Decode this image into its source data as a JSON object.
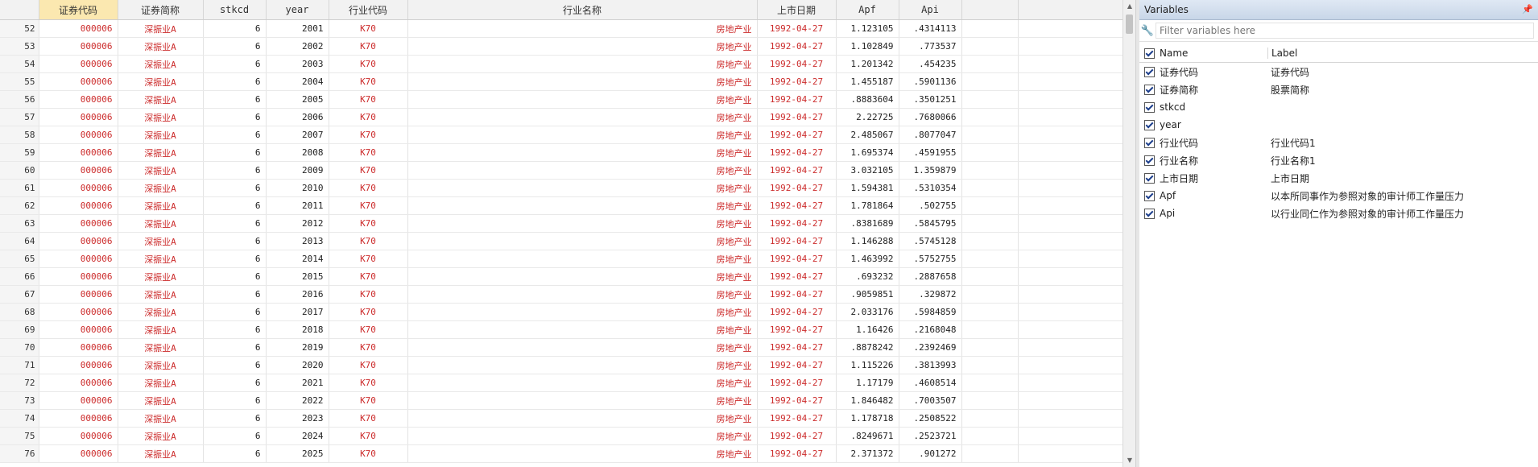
{
  "data_grid": {
    "columns": [
      "",
      "证券代码",
      "证券简称",
      "stkcd",
      "year",
      "行业代码",
      "行业名称",
      "上市日期",
      "Apf",
      "Api",
      "",
      ""
    ],
    "rows": [
      {
        "n": "52",
        "code": "000006",
        "short": "深振业A",
        "stkcd": "6",
        "year": "2001",
        "ind": "K70",
        "indname": "房地产业",
        "date": "1992-04-27",
        "apf": "1.123105",
        "api": ".4314113"
      },
      {
        "n": "53",
        "code": "000006",
        "short": "深振业A",
        "stkcd": "6",
        "year": "2002",
        "ind": "K70",
        "indname": "房地产业",
        "date": "1992-04-27",
        "apf": "1.102849",
        "api": ".773537"
      },
      {
        "n": "54",
        "code": "000006",
        "short": "深振业A",
        "stkcd": "6",
        "year": "2003",
        "ind": "K70",
        "indname": "房地产业",
        "date": "1992-04-27",
        "apf": "1.201342",
        "api": ".454235"
      },
      {
        "n": "55",
        "code": "000006",
        "short": "深振业A",
        "stkcd": "6",
        "year": "2004",
        "ind": "K70",
        "indname": "房地产业",
        "date": "1992-04-27",
        "apf": "1.455187",
        "api": ".5901136"
      },
      {
        "n": "56",
        "code": "000006",
        "short": "深振业A",
        "stkcd": "6",
        "year": "2005",
        "ind": "K70",
        "indname": "房地产业",
        "date": "1992-04-27",
        "apf": ".8883604",
        "api": ".3501251"
      },
      {
        "n": "57",
        "code": "000006",
        "short": "深振业A",
        "stkcd": "6",
        "year": "2006",
        "ind": "K70",
        "indname": "房地产业",
        "date": "1992-04-27",
        "apf": "2.22725",
        "api": ".7680066"
      },
      {
        "n": "58",
        "code": "000006",
        "short": "深振业A",
        "stkcd": "6",
        "year": "2007",
        "ind": "K70",
        "indname": "房地产业",
        "date": "1992-04-27",
        "apf": "2.485067",
        "api": ".8077047"
      },
      {
        "n": "59",
        "code": "000006",
        "short": "深振业A",
        "stkcd": "6",
        "year": "2008",
        "ind": "K70",
        "indname": "房地产业",
        "date": "1992-04-27",
        "apf": "1.695374",
        "api": ".4591955"
      },
      {
        "n": "60",
        "code": "000006",
        "short": "深振业A",
        "stkcd": "6",
        "year": "2009",
        "ind": "K70",
        "indname": "房地产业",
        "date": "1992-04-27",
        "apf": "3.032105",
        "api": "1.359879"
      },
      {
        "n": "61",
        "code": "000006",
        "short": "深振业A",
        "stkcd": "6",
        "year": "2010",
        "ind": "K70",
        "indname": "房地产业",
        "date": "1992-04-27",
        "apf": "1.594381",
        "api": ".5310354"
      },
      {
        "n": "62",
        "code": "000006",
        "short": "深振业A",
        "stkcd": "6",
        "year": "2011",
        "ind": "K70",
        "indname": "房地产业",
        "date": "1992-04-27",
        "apf": "1.781864",
        "api": ".502755"
      },
      {
        "n": "63",
        "code": "000006",
        "short": "深振业A",
        "stkcd": "6",
        "year": "2012",
        "ind": "K70",
        "indname": "房地产业",
        "date": "1992-04-27",
        "apf": ".8381689",
        "api": ".5845795"
      },
      {
        "n": "64",
        "code": "000006",
        "short": "深振业A",
        "stkcd": "6",
        "year": "2013",
        "ind": "K70",
        "indname": "房地产业",
        "date": "1992-04-27",
        "apf": "1.146288",
        "api": ".5745128"
      },
      {
        "n": "65",
        "code": "000006",
        "short": "深振业A",
        "stkcd": "6",
        "year": "2014",
        "ind": "K70",
        "indname": "房地产业",
        "date": "1992-04-27",
        "apf": "1.463992",
        "api": ".5752755"
      },
      {
        "n": "66",
        "code": "000006",
        "short": "深振业A",
        "stkcd": "6",
        "year": "2015",
        "ind": "K70",
        "indname": "房地产业",
        "date": "1992-04-27",
        "apf": ".693232",
        "api": ".2887658"
      },
      {
        "n": "67",
        "code": "000006",
        "short": "深振业A",
        "stkcd": "6",
        "year": "2016",
        "ind": "K70",
        "indname": "房地产业",
        "date": "1992-04-27",
        "apf": ".9059851",
        "api": ".329872"
      },
      {
        "n": "68",
        "code": "000006",
        "short": "深振业A",
        "stkcd": "6",
        "year": "2017",
        "ind": "K70",
        "indname": "房地产业",
        "date": "1992-04-27",
        "apf": "2.033176",
        "api": ".5984859"
      },
      {
        "n": "69",
        "code": "000006",
        "short": "深振业A",
        "stkcd": "6",
        "year": "2018",
        "ind": "K70",
        "indname": "房地产业",
        "date": "1992-04-27",
        "apf": "1.16426",
        "api": ".2168048"
      },
      {
        "n": "70",
        "code": "000006",
        "short": "深振业A",
        "stkcd": "6",
        "year": "2019",
        "ind": "K70",
        "indname": "房地产业",
        "date": "1992-04-27",
        "apf": ".8878242",
        "api": ".2392469"
      },
      {
        "n": "71",
        "code": "000006",
        "short": "深振业A",
        "stkcd": "6",
        "year": "2020",
        "ind": "K70",
        "indname": "房地产业",
        "date": "1992-04-27",
        "apf": "1.115226",
        "api": ".3813993"
      },
      {
        "n": "72",
        "code": "000006",
        "short": "深振业A",
        "stkcd": "6",
        "year": "2021",
        "ind": "K70",
        "indname": "房地产业",
        "date": "1992-04-27",
        "apf": "1.17179",
        "api": ".4608514"
      },
      {
        "n": "73",
        "code": "000006",
        "short": "深振业A",
        "stkcd": "6",
        "year": "2022",
        "ind": "K70",
        "indname": "房地产业",
        "date": "1992-04-27",
        "apf": "1.846482",
        "api": ".7003507"
      },
      {
        "n": "74",
        "code": "000006",
        "short": "深振业A",
        "stkcd": "6",
        "year": "2023",
        "ind": "K70",
        "indname": "房地产业",
        "date": "1992-04-27",
        "apf": "1.178718",
        "api": ".2508522"
      },
      {
        "n": "75",
        "code": "000006",
        "short": "深振业A",
        "stkcd": "6",
        "year": "2024",
        "ind": "K70",
        "indname": "房地产业",
        "date": "1992-04-27",
        "apf": ".8249671",
        "api": ".2523721"
      },
      {
        "n": "76",
        "code": "000006",
        "short": "深振业A",
        "stkcd": "6",
        "year": "2025",
        "ind": "K70",
        "indname": "房地产业",
        "date": "1992-04-27",
        "apf": "2.371372",
        "api": ".901272"
      }
    ]
  },
  "variables_panel": {
    "title": "Variables",
    "pin_icon": "pin-icon",
    "filter_placeholder": "Filter variables here",
    "header_name": "Name",
    "header_label": "Label",
    "items": [
      {
        "name": "证券代码",
        "label": "证券代码"
      },
      {
        "name": "证券简称",
        "label": "股票简称"
      },
      {
        "name": "stkcd",
        "label": ""
      },
      {
        "name": "year",
        "label": ""
      },
      {
        "name": "行业代码",
        "label": "行业代码1"
      },
      {
        "name": "行业名称",
        "label": "行业名称1"
      },
      {
        "name": "上市日期",
        "label": "上市日期"
      },
      {
        "name": "Apf",
        "label": "以本所同事作为参照对象的审计师工作量压力"
      },
      {
        "name": "Api",
        "label": "以行业同仁作为参照对象的审计师工作量压力"
      }
    ]
  },
  "colors": {
    "selected_header": "#fbe8b0",
    "string_text": "#cc2b2b",
    "panel_title_bg": "#c8d6e8"
  }
}
